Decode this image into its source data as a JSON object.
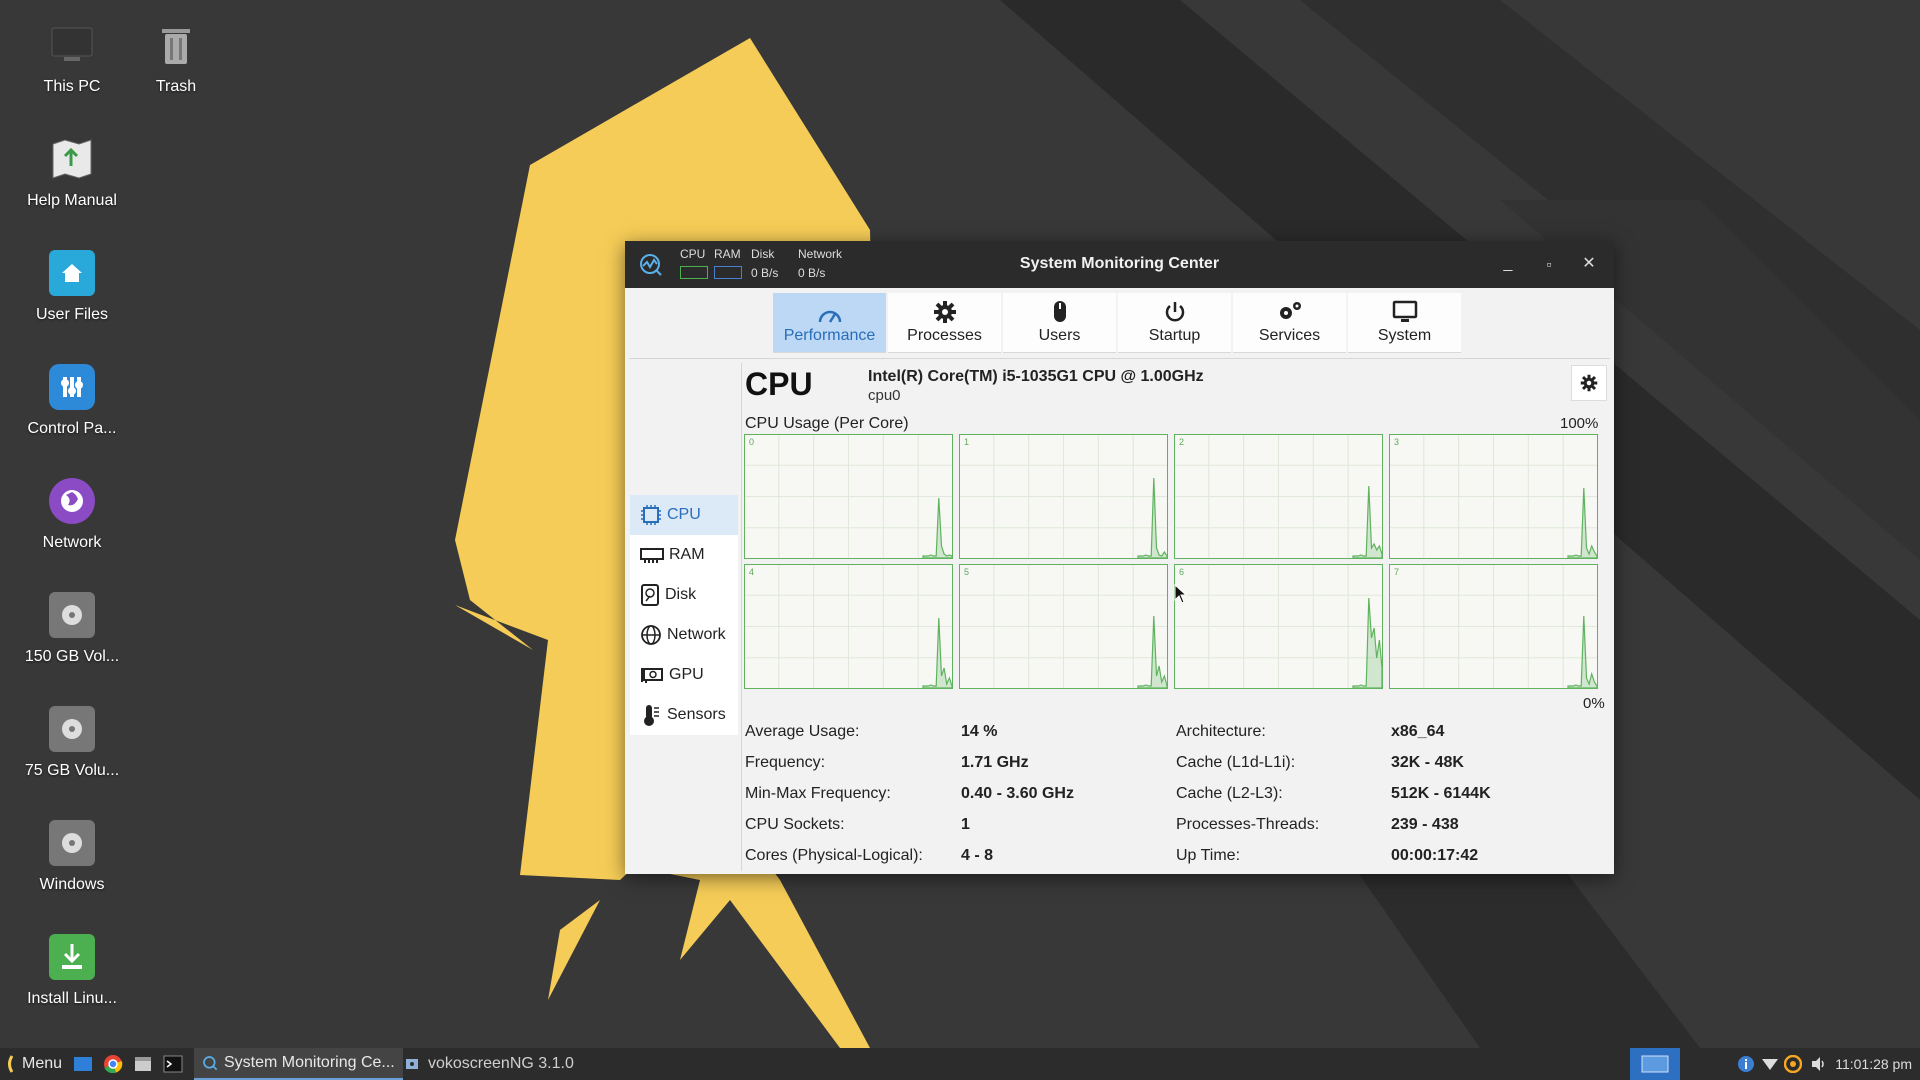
{
  "desktop": {
    "icons": [
      {
        "label": "This PC",
        "icon": "computer-icon"
      },
      {
        "label": "Trash",
        "icon": "trash-icon"
      },
      {
        "label": "Help Manual",
        "icon": "map-icon"
      },
      {
        "label": "User Files",
        "icon": "home-folder-icon"
      },
      {
        "label": "Control Pa...",
        "icon": "control-panel-icon"
      },
      {
        "label": "Network",
        "icon": "network-globe-icon"
      },
      {
        "label": "150 GB Vol...",
        "icon": "drive-icon"
      },
      {
        "label": "75 GB Volu...",
        "icon": "drive-icon"
      },
      {
        "label": "Windows",
        "icon": "drive-icon"
      },
      {
        "label": "Install Linu...",
        "icon": "install-icon"
      }
    ]
  },
  "window": {
    "title": "System Monitoring Center",
    "mini": {
      "cpu_label": "CPU",
      "ram_label": "RAM",
      "disk_label": "Disk",
      "disk_rate": "0 B/s",
      "network_label": "Network",
      "network_rate": "0 B/s"
    },
    "controls": {
      "minimize": "_",
      "maximize": "▫",
      "close": "✕"
    }
  },
  "tabs": [
    {
      "label": "Performance",
      "icon": "gauge-icon",
      "active": true
    },
    {
      "label": "Processes",
      "icon": "gear-icon"
    },
    {
      "label": "Users",
      "icon": "mouse-icon"
    },
    {
      "label": "Startup",
      "icon": "power-icon"
    },
    {
      "label": "Services",
      "icon": "services-gears-icon"
    },
    {
      "label": "System",
      "icon": "monitor-icon"
    }
  ],
  "sidebar": {
    "items": [
      {
        "label": "CPU",
        "icon": "cpu-chip-icon",
        "active": true
      },
      {
        "label": "RAM",
        "icon": "ram-module-icon"
      },
      {
        "label": "Disk",
        "icon": "disk-icon"
      },
      {
        "label": "Network",
        "icon": "globe-icon"
      },
      {
        "label": "GPU",
        "icon": "gpu-card-icon"
      },
      {
        "label": "Sensors",
        "icon": "thermometer-icon"
      }
    ]
  },
  "cpu": {
    "title": "CPU",
    "model": "Intel(R) Core(TM) i5-1035G1 CPU @ 1.00GHz",
    "id": "cpu0",
    "graph_caption": "CPU Usage (Per Core)",
    "scale_top": "100%",
    "scale_bottom": "0%",
    "cores": [
      "0",
      "1",
      "2",
      "3",
      "4",
      "5",
      "6",
      "7"
    ],
    "accent": "#5fb35f",
    "stats_left": [
      {
        "label": "Average Usage:",
        "value": "14 %"
      },
      {
        "label": "Frequency:",
        "value": "1.71 GHz"
      },
      {
        "label": "Min-Max Frequency:",
        "value": "0.40 - 3.60 GHz"
      },
      {
        "label": "CPU Sockets:",
        "value": "1"
      },
      {
        "label": "Cores (Physical-Logical):",
        "value": "4 - 8"
      }
    ],
    "stats_right": [
      {
        "label": "Architecture:",
        "value": "x86_64"
      },
      {
        "label": "Cache (L1d-L1i):",
        "value": "32K - 48K"
      },
      {
        "label": "Cache (L2-L3):",
        "value": "512K - 6144K"
      },
      {
        "label": "Processes-Threads:",
        "value": "239 - 438"
      },
      {
        "label": "Up Time:",
        "value": "00:00:17:42"
      }
    ]
  },
  "taskbar": {
    "menu_label": "Menu",
    "tasks": [
      {
        "label": "System Monitoring Ce...",
        "active": true
      },
      {
        "label": "vokoscreenNG 3.1.0",
        "active": false
      }
    ],
    "clock": "11:01:28 pm"
  }
}
